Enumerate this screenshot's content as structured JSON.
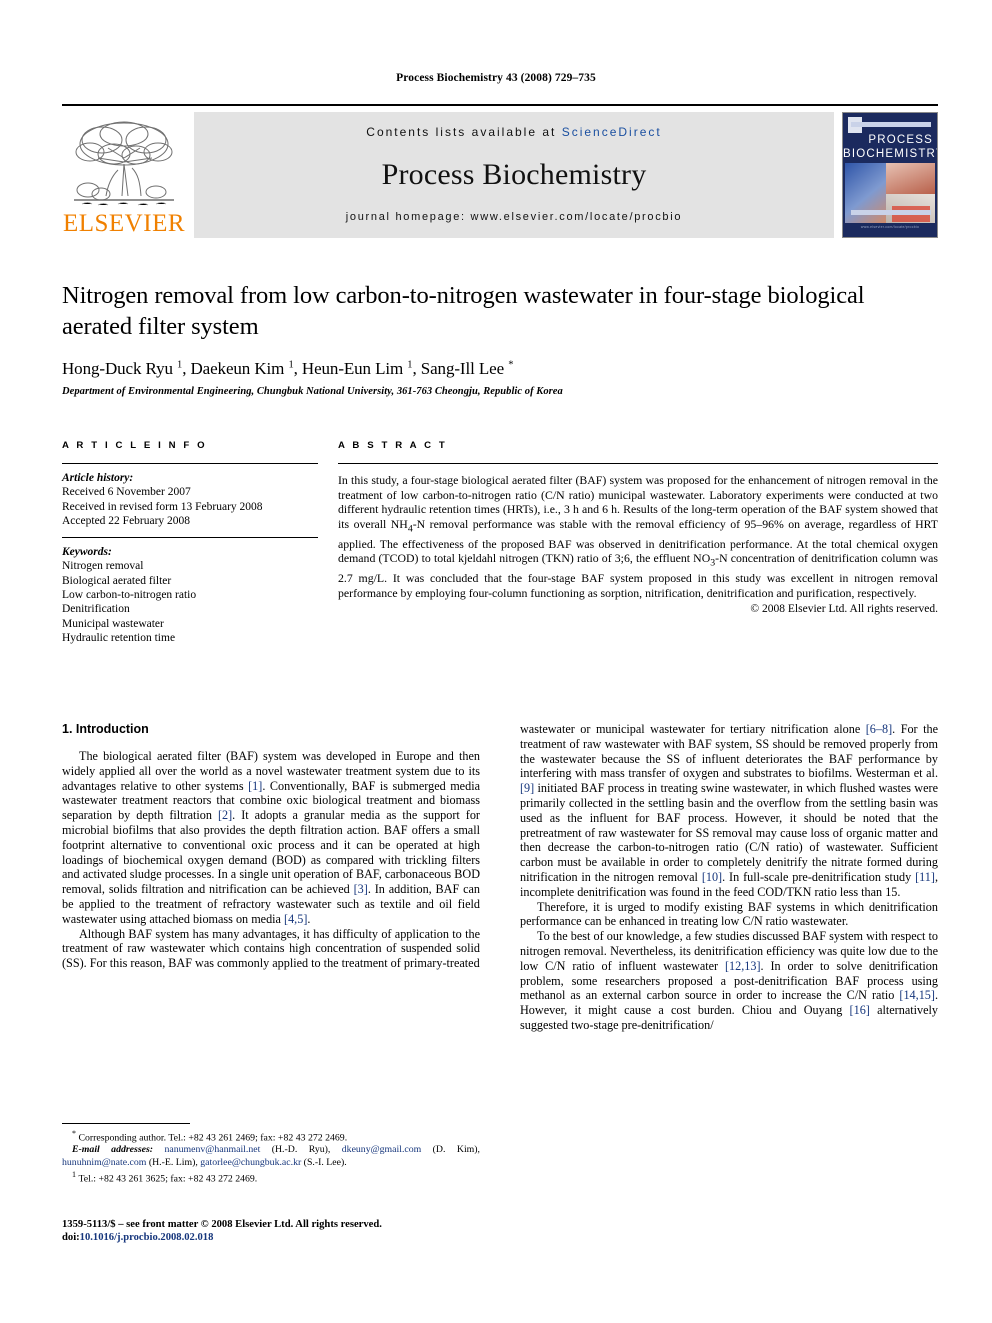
{
  "running_head": "Process Biochemistry 43 (2008) 729–735",
  "masthead": {
    "publisher_name": "ELSEVIER",
    "contents_prefix": "Contents lists available at ",
    "sciencedirect": "ScienceDirect",
    "journal_title": "Process Biochemistry",
    "homepage": "journal homepage: www.elsevier.com/locate/procbio",
    "cover_title_line1": "PROCESS",
    "cover_title_line2": "BIOCHEMISTRY"
  },
  "article": {
    "title": "Nitrogen removal from low carbon-to-nitrogen wastewater in four-stage biological aerated filter system",
    "authors_html": "Hong-Duck Ryu <sup>1</sup>, Daekeun Kim <sup>1</sup>, Heun-Eun Lim <sup>1</sup>, Sang-Ill Lee <sup>*</sup>",
    "affiliation": "Department of Environmental Engineering, Chungbuk National University, 361-763 Cheongju, Republic of Korea"
  },
  "article_info": {
    "label": "A R T I C L E   I N F O",
    "history_head": "Article history:",
    "history": [
      "Received 6 November 2007",
      "Received in revised form 13 February 2008",
      "Accepted 22 February 2008"
    ],
    "keywords_head": "Keywords:",
    "keywords": [
      "Nitrogen removal",
      "Biological aerated filter",
      "Low carbon-to-nitrogen ratio",
      "Denitrification",
      "Municipal wastewater",
      "Hydraulic retention time"
    ]
  },
  "abstract": {
    "label": "A B S T R A C T",
    "text_html": "In this study, a four-stage biological aerated filter (BAF) system was proposed for the enhancement of nitrogen removal in the treatment of low carbon-to-nitrogen ratio (C/N ratio) municipal wastewater. Laboratory experiments were conducted at two different hydraulic retention times (HRTs), i.e., 3 h and 6 h. Results of the long-term operation of the BAF system showed that its overall NH<sub>4</sub>-N removal performance was stable with the removal efficiency of 95&ndash;96% on average, regardless of HRT applied. The effectiveness of the proposed BAF was observed in denitrification performance. At the total chemical oxygen demand (TCOD) to total kjeldahl nitrogen (TKN) ratio of 3;6, the effluent NO<sub>3</sub>-N concentration of denitrification column was 2.7 mg/L. It was concluded that the four-stage BAF system proposed in this study was excellent in nitrogen removal performance by employing four-column functioning as sorption, nitrification, denitrification and purification, respectively.",
    "copyright": "© 2008 Elsevier Ltd. All rights reserved."
  },
  "introduction": {
    "section_title": "1. Introduction",
    "left_paragraphs_html": [
      "The biological aerated filter (BAF) system was developed in Europe and then widely applied all over the world as a novel wastewater treatment system due to its advantages relative to other systems <span class=\"ref\">[1]</span>. Conventionally, BAF is submerged media wastewater treatment reactors that combine oxic biological treatment and biomass separation by depth filtration <span class=\"ref\">[2]</span>. It adopts a granular media as the support for microbial biofilms that also provides the depth filtration action. BAF offers a small footprint alternative to conventional oxic process and it can be operated at high loadings of biochemical oxygen demand (BOD) as compared with trickling filters and activated sludge processes. In a single unit operation of BAF, carbonaceous BOD removal, solids filtration and nitrification can be achieved <span class=\"ref\">[3]</span>. In addition, BAF can be applied to the treatment of refractory wastewater such as textile and oil field wastewater using attached biomass on media <span class=\"ref\">[4,5]</span>.",
      "Although BAF system has many advantages, it has difficulty of application to the treatment of raw wastewater which contains high concentration of suspended solid (SS). For this reason, BAF was commonly applied to the treatment of primary-treated"
    ],
    "right_paragraphs_html": [
      "wastewater or municipal wastewater for tertiary nitrification alone <span class=\"ref\">[6&ndash;8]</span>. For the treatment of raw wastewater with BAF system, SS should be removed properly from the wastewater because the SS of influent deteriorates the BAF performance by interfering with mass transfer of oxygen and substrates to biofilms. Westerman et al. <span class=\"ref\">[9]</span> initiated BAF process in treating swine wastewater, in which flushed wastes were primarily collected in the settling basin and the overflow from the settling basin was used as the influent for BAF process. However, it should be noted that the pretreatment of raw wastewater for SS removal may cause loss of organic matter and then decrease the carbon-to-nitrogen ratio (C/N ratio) of wastewater. Sufficient carbon must be available in order to completely denitrify the nitrate formed during nitrification in the nitrogen removal <span class=\"ref\">[10]</span>. In full-scale pre-denitrification study <span class=\"ref\">[11]</span>, incomplete denitrification was found in the feed COD/TKN ratio less than 15.",
      "Therefore, it is urged to modify existing BAF systems in which denitrification performance can be enhanced in treating low C/N ratio wastewater.",
      "To the best of our knowledge, a few studies discussed BAF system with respect to nitrogen removal. Nevertheless, its denitrification efficiency was quite low due to the low C/N ratio of influent wastewater <span class=\"ref\">[12,13]</span>. In order to solve denitrification problem, some researchers proposed a post-denitrification BAF process using methanol as an external carbon source in order to increase the C/N ratio <span class=\"ref\">[14,15]</span>. However, it might cause a cost burden. Chiou and Ouyang <span class=\"ref\">[16]</span> alternatively suggested two-stage pre-denitrification/"
    ]
  },
  "footnotes": {
    "corresponding_html": "<span class=\"fn-sym\">*</span>&nbsp;Corresponding author. Tel.: +82 43 261 2469; fax: +82 43 272 2469.",
    "emails_html": "<span class=\"fn-italic\">E-mail addresses:</span> <span class=\"mailto\">nanumenv@hanmail.net</span> (H.-D. Ryu), <span class=\"mailto\">dkeuny@gmail.com</span> (D. Kim), <span class=\"mailto\">hunuhnim@nate.com</span> (H.-E. Lim), <span class=\"mailto\">gatorlee@chungbuk.ac.kr</span> (S.-I. Lee).",
    "tel_html": "<span class=\"fn-sym\">1</span>&nbsp;Tel.: +82 43 261 3625; fax: +82 43 272 2469."
  },
  "frontmatter": {
    "issn_line": "1359-5113/$ – see front matter © 2008 Elsevier Ltd. All rights reserved.",
    "doi_prefix": "doi:",
    "doi_value": "10.1016/j.procbio.2008.02.018"
  }
}
